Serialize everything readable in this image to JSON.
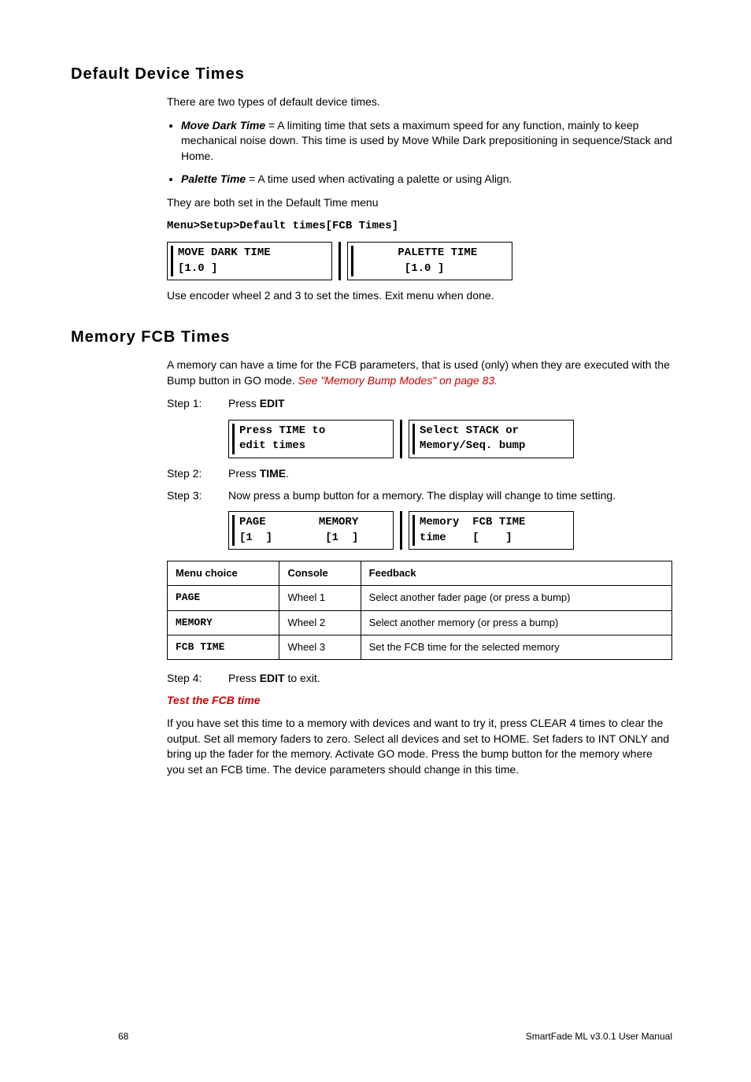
{
  "section1": {
    "heading": "Default Device Times",
    "intro": "There are two types of default device times.",
    "bullets": [
      {
        "term": "Move Dark Time",
        "def": " = A limiting time that sets a maximum speed for any function, mainly to keep mechanical noise down. This time is used by Move While Dark prepositioning in sequence/Stack and Home."
      },
      {
        "term": "Palette Time",
        "def": " = A time used when activating a palette or using Align."
      }
    ],
    "after_bullets": "They are both set in the Default Time menu",
    "menu_path": "Menu>Setup>Default times[FCB Times]",
    "lcd": {
      "left": "MOVE DARK TIME\n[1.0 ]",
      "right": "      PALETTE TIME\n       [1.0 ]"
    },
    "after_lcd": "Use encoder wheel 2 and 3 to set the times. Exit menu when done."
  },
  "section2": {
    "heading": "Memory FCB Times",
    "intro_text": "A memory can have a time for the FCB parameters, that is used (only) when they are executed with the Bump button in GO mode. ",
    "intro_link": "See \"Memory Bump Modes\" on page 83.",
    "step1": {
      "label": "Step 1:",
      "pre": "Press ",
      "bold": "EDIT"
    },
    "lcd1": {
      "left": "Press TIME to\nedit times",
      "right": "Select STACK or\nMemory/Seq. bump"
    },
    "step2": {
      "label": "Step 2:",
      "pre": "Press ",
      "bold": "TIME",
      "post": "."
    },
    "step3": {
      "label": "Step 3:",
      "text": "Now press a bump button for a memory. The display will change to time setting."
    },
    "lcd2": {
      "left": "PAGE        MEMORY\n[1  ]        [1  ]",
      "right": "Memory  FCB TIME\ntime    [    ]"
    },
    "table": {
      "headers": [
        "Menu choice",
        "Console",
        "Feedback"
      ],
      "rows": [
        {
          "c0": "PAGE",
          "c1": "Wheel 1",
          "c2": "Select another fader page (or press a bump)"
        },
        {
          "c0": "MEMORY",
          "c1": "Wheel 2",
          "c2": "Select another memory (or press a bump)"
        },
        {
          "c0": "FCB TIME",
          "c1": "Wheel 3",
          "c2": "Set the FCB time for the selected memory"
        }
      ]
    },
    "step4": {
      "label": "Step 4:",
      "pre": "Press ",
      "bold": "EDIT",
      "post": " to exit."
    },
    "sub_heading": "Test the FCB time",
    "sub_para": "If you have set this time to a memory with devices and want to try it, press CLEAR 4 times to clear the output. Set all memory faders to zero. Select all devices and set to HOME. Set faders to INT ONLY and bring up the fader for the memory. Activate GO mode. Press the bump button for the memory where you set an FCB time. The device parameters should change in this time."
  },
  "footer": {
    "page": "68",
    "title": "SmartFade ML v3.0.1 User Manual"
  }
}
